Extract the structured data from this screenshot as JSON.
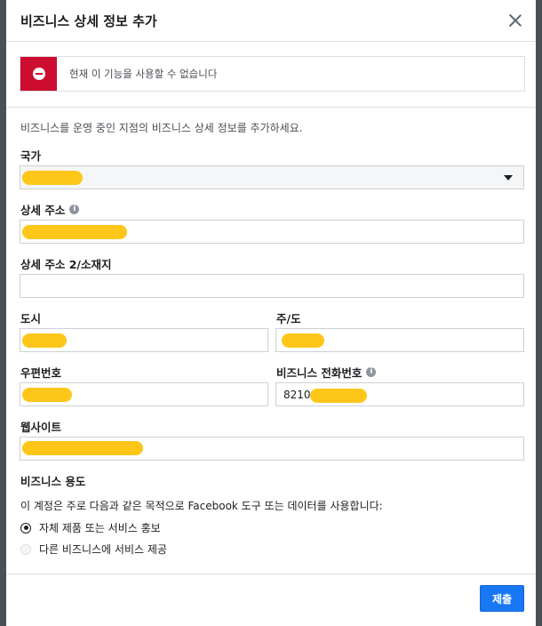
{
  "dialog": {
    "title": "비즈니스 상세 정보 추가",
    "alert_text": "현재 이 기능을 사용할 수 없습니다",
    "intro": "비즈니스를 운영 중인 지점의 비즈니스 상세 정보를 추가하세요."
  },
  "form": {
    "country_label": "국가",
    "address_label": "상세 주소",
    "address2_label": "상세 주소 2/소재지",
    "city_label": "도시",
    "state_label": "주/도",
    "postal_label": "우편번호",
    "phone_label": "비즈니스 전화번호",
    "phone_value": "8210",
    "website_label": "웹사이트",
    "usage_label": "비즈니스 용도",
    "usage_question": "이 계정은 주로 다음과 같은 목적으로 Facebook 도구 또는 데이터를 사용합니다:",
    "option_1": "자체 제품 또는 서비스 홍보",
    "option_2": "다른 비즈니스에 서비스 제공"
  },
  "footer": {
    "submit_label": "제출"
  },
  "colors": {
    "alert_red": "#cc0d2f",
    "primary_blue": "#1877f2",
    "redaction_yellow": "#ffc61a"
  },
  "icons": [
    "close-icon",
    "error-icon",
    "info-icon",
    "dropdown-caret-icon"
  ]
}
